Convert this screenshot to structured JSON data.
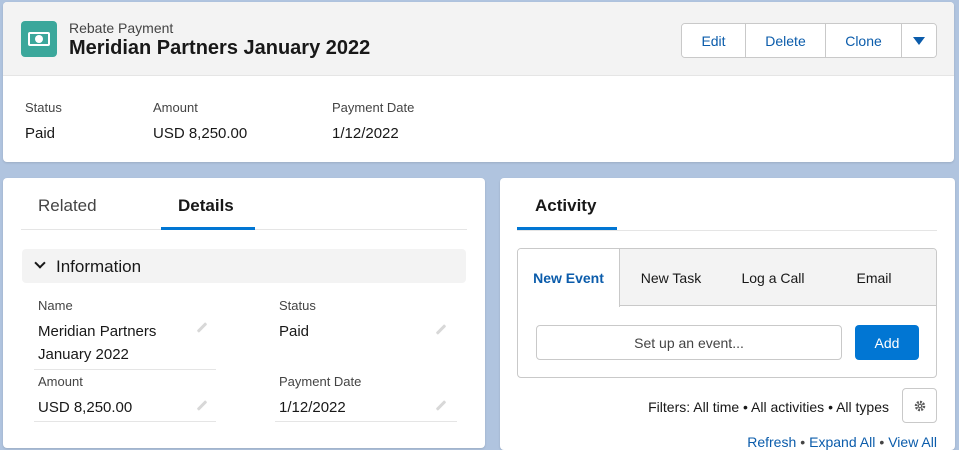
{
  "header": {
    "object_type": "Rebate Payment",
    "record_name": "Meridian Partners January 2022",
    "actions": {
      "edit": "Edit",
      "delete": "Delete",
      "clone": "Clone"
    },
    "highlights": [
      {
        "label": "Status",
        "value": "Paid"
      },
      {
        "label": "Amount",
        "value": "USD 8,250.00"
      },
      {
        "label": "Payment Date",
        "value": "1/12/2022"
      }
    ],
    "icon": "money-icon",
    "icon_color": "#3ba79b"
  },
  "details": {
    "tabs": {
      "related": "Related",
      "details": "Details"
    },
    "section": "Information",
    "fields": {
      "name": {
        "label": "Name",
        "value_line1": "Meridian Partners",
        "value_line2": "January 2022"
      },
      "status": {
        "label": "Status",
        "value": "Paid"
      },
      "amount": {
        "label": "Amount",
        "value": "USD 8,250.00"
      },
      "payment_date": {
        "label": "Payment Date",
        "value": "1/12/2022"
      }
    }
  },
  "activity": {
    "tab": "Activity",
    "publisher_tabs": {
      "new_event": "New Event",
      "new_task": "New Task",
      "log_call": "Log a Call",
      "email": "Email"
    },
    "input_placeholder": "Set up an event...",
    "add_label": "Add",
    "filters": "Filters: All time • All activities • All types",
    "links": {
      "refresh": "Refresh",
      "expand_all": "Expand All",
      "view_all": "View All",
      "separator": "•"
    }
  },
  "colors": {
    "brand": "#0176d3",
    "link": "#0b5cab",
    "page_bg": "#b0c4df"
  }
}
